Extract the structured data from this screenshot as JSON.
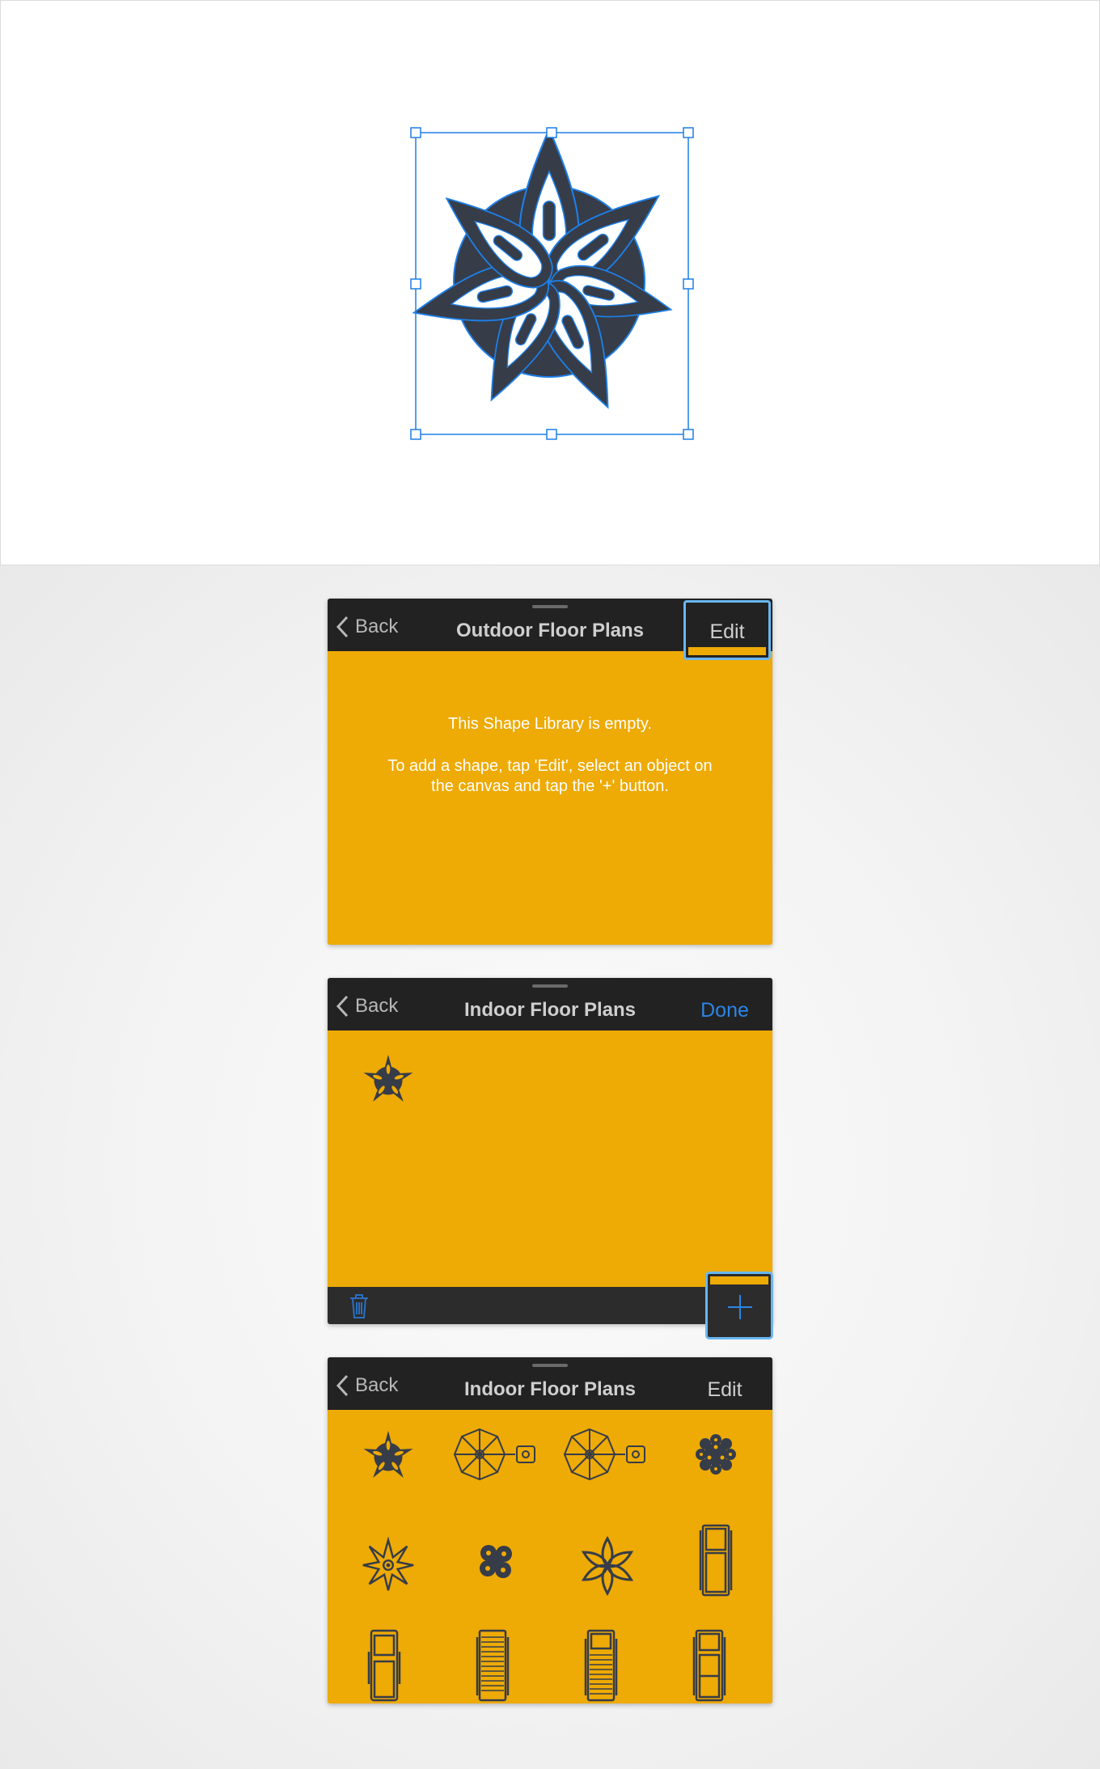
{
  "colors": {
    "panel": "#eeaa05",
    "bar": "#222222",
    "accent": "#2a86e8",
    "shape": "#363c48",
    "selection": "#1e7fe6"
  },
  "panels": [
    {
      "back_label": "Back",
      "back_icon": "chevron-left-icon",
      "title": "Outdoor Floor Plans",
      "right_button": "Edit",
      "message_line1": "This Shape Library is empty.",
      "message_line2": "To add a shape, tap 'Edit', select an object on the canvas and tap the '+' button."
    },
    {
      "back_label": "Back",
      "back_icon": "chevron-left-icon",
      "title": "Indoor Floor Plans",
      "right_button": "Done",
      "items": [
        "star-flower-shape"
      ],
      "toolbar_icons": [
        "trash-icon",
        "plus-icon"
      ]
    },
    {
      "back_label": "Back",
      "back_icon": "chevron-left-icon",
      "title": "Indoor Floor Plans",
      "right_button": "Edit",
      "items": [
        "star-flower-shape",
        "umbrella-table-shape",
        "umbrella-table-shape",
        "round-bush-shape",
        "spiky-star-shape",
        "shrub-shape",
        "flower-shape",
        "lounger-shape",
        "lounger-shape",
        "sunbed-shape",
        "sunbed-shape",
        "lounger-shape"
      ]
    }
  ]
}
